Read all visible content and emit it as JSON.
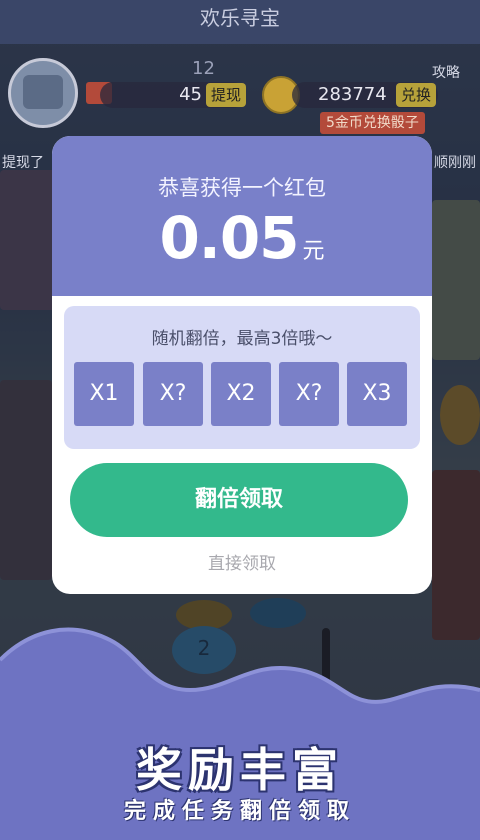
{
  "header": {
    "title": "欢乐寻宝"
  },
  "hud": {
    "level": "12",
    "cash_value": "45",
    "withdraw_label": "提现",
    "coins_value": "283774",
    "exchange_label": "兑换",
    "exchange_hint": "5金币兑换骰子",
    "strategy_label": "攻略",
    "left_ticker": "提现了",
    "right_ticker": "顺刚刚"
  },
  "board": {
    "step_number": "2"
  },
  "modal": {
    "title": "恭喜获得一个红包",
    "amount": "0.05",
    "unit": "元",
    "multiplier_label": "随机翻倍，最高3倍哦～",
    "multipliers": [
      "X1",
      "X?",
      "X2",
      "X?",
      "X3"
    ],
    "double_button": "翻倍领取",
    "direct_link": "直接领取"
  },
  "banner": {
    "headline": "奖励丰富",
    "subline": "完成任务翻倍领取"
  },
  "colors": {
    "modal_header": "#7980c9",
    "multiplier_cell": "#7a80c8",
    "cta_green": "#33b98c",
    "banner_cloud": "#6e73c2"
  }
}
